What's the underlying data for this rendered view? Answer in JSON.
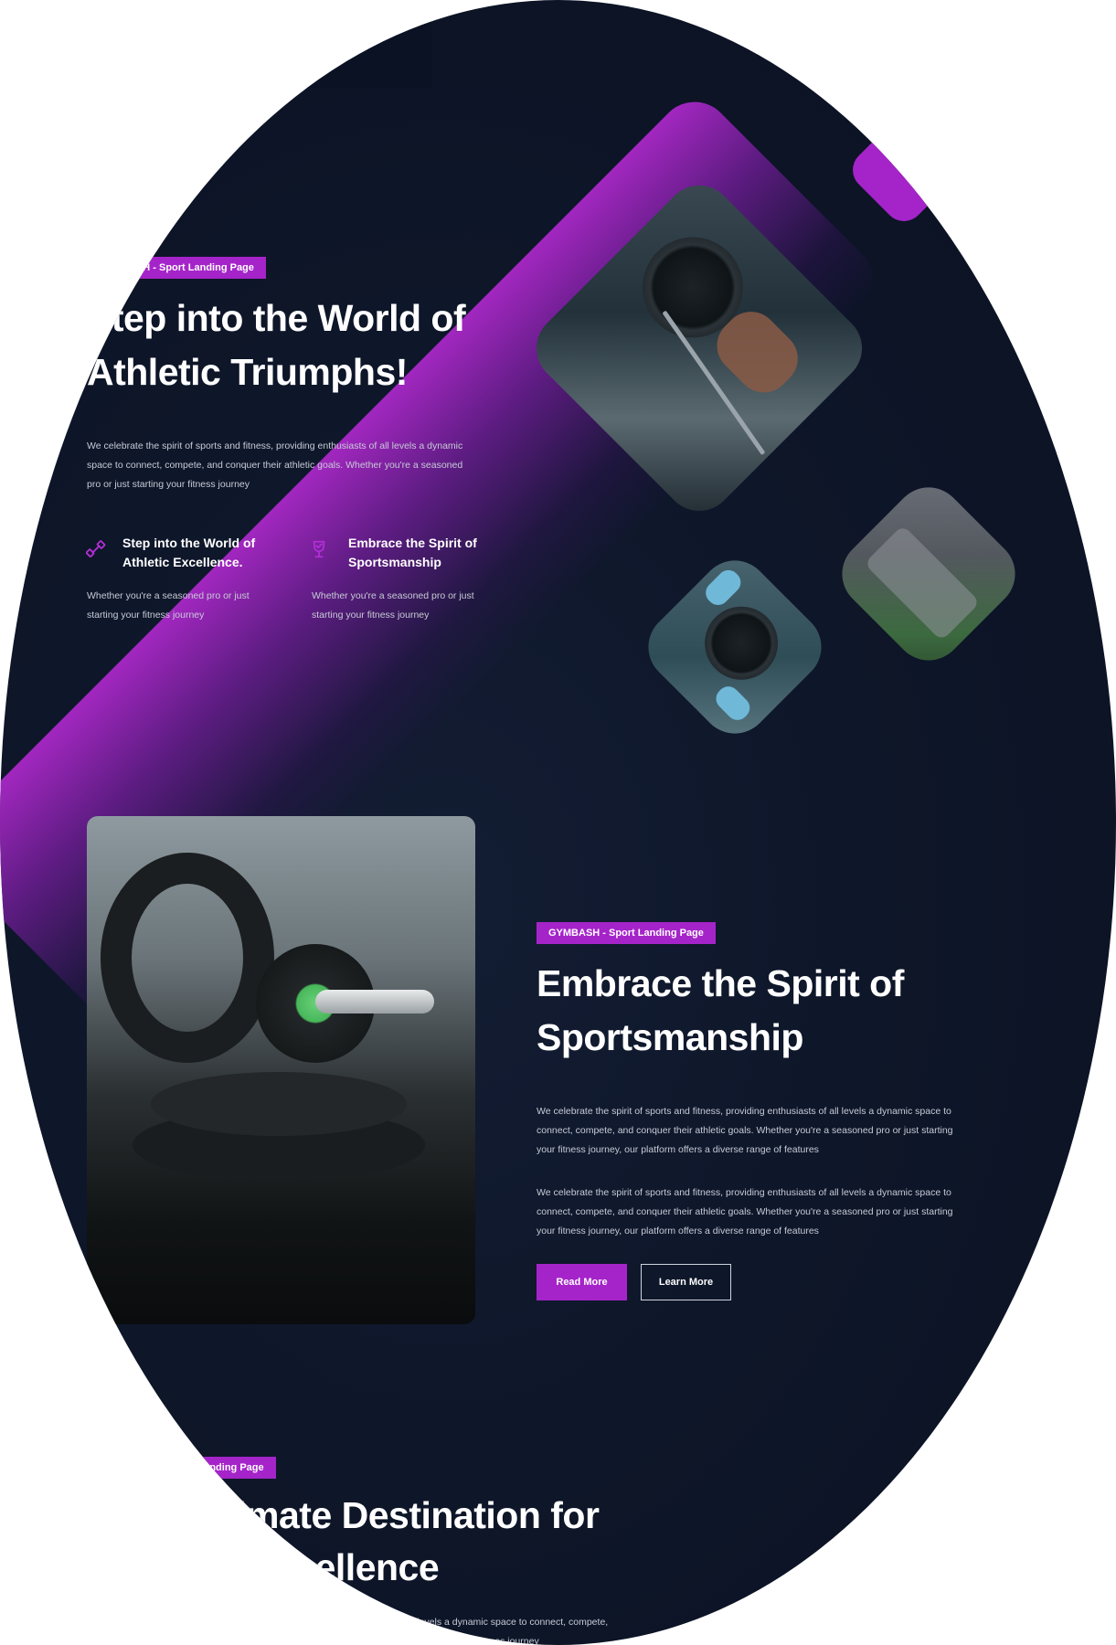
{
  "hero": {
    "badge": "GYMBASH - Sport Landing Page",
    "title_line1": "Step into the World of",
    "title_line2": "Athletic Triumphs!",
    "description_lines": [
      "We celebrate the spirit of sports and fitness, providing enthusiasts of all levels a dynamic",
      "space to connect, compete, and conquer their athletic goals. Whether you're a seasoned",
      "pro or just starting your fitness journey"
    ],
    "features": [
      {
        "icon": "dumbbell-icon",
        "title_line1": "Step into the World of",
        "title_line2": "Athletic Excellence.",
        "text_line1": "Whether you're a seasoned pro or just",
        "text_line2": "starting your fitness journey"
      },
      {
        "icon": "trophy-check-icon",
        "title_line1": "Embrace the Spirit of",
        "title_line2": "Sportsmanship",
        "text_line1": "Whether you're a seasoned pro or just",
        "text_line2": "starting your fitness journey"
      }
    ]
  },
  "about": {
    "badge": "GYMBASH - Sport Landing Page",
    "title_line1": "Embrace the Spirit of",
    "title_line2": "Sportsmanship",
    "paragraph1_lines": [
      "We celebrate the spirit of sports and fitness, providing enthusiasts of all levels a dynamic space to",
      "connect, compete, and conquer their athletic goals. Whether you're a seasoned pro or just starting",
      "your fitness journey, our platform offers a diverse range of features"
    ],
    "paragraph2_lines": [
      "We celebrate the spirit of sports and fitness, providing enthusiasts of all levels a dynamic space to",
      "connect, compete, and conquer their athletic goals. Whether you're a seasoned pro or just starting",
      "your fitness journey, our platform offers a diverse range of features"
    ],
    "primary_button": "Read More",
    "secondary_button": "Learn More"
  },
  "destination": {
    "badge": "H - Sport Landing Page",
    "title_line1": "Ultimate Destination for",
    "title_line2": "xcellence",
    "text_line1": "f all levels a dynamic space to connect, compete,",
    "text_line2": "fitness journey"
  },
  "colors": {
    "accent": "#a524c9",
    "background": "#0e1629",
    "page": "#ffffff"
  }
}
